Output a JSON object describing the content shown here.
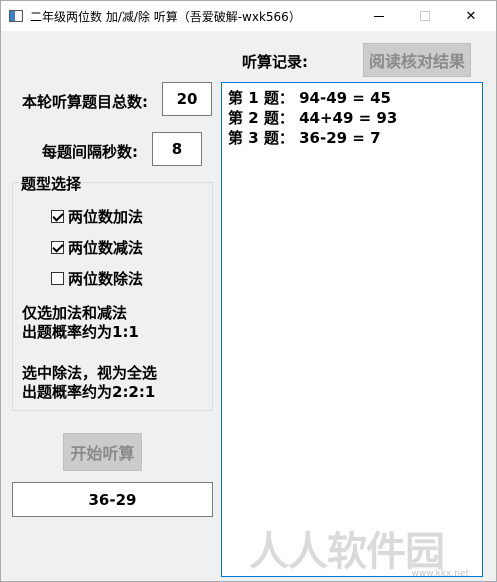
{
  "window": {
    "title": "二年级两位数 加/减/除 听算（吾爱破解-wxk566）",
    "minimize_icon": "minimize-icon",
    "maximize_icon": "maximize-icon",
    "close_glyph": "✕"
  },
  "settings": {
    "total_label": "本轮听算题目总数:",
    "total_value": "20",
    "interval_label": "每题间隔秒数:",
    "interval_value": "8"
  },
  "question_types": {
    "title": "题型选择",
    "options": [
      {
        "label": "两位数加法",
        "checked": true
      },
      {
        "label": "两位数减法",
        "checked": true
      },
      {
        "label": "两位数除法",
        "checked": false
      }
    ],
    "note1_line1": "仅选加法和减法",
    "note1_line2": "出题概率约为1:1",
    "note2_line1": "选中除法，视为全选",
    "note2_line2": "出题概率约为2:2:1"
  },
  "controls": {
    "start_label": "开始听算",
    "current_question": "36-29"
  },
  "records": {
    "title": "听算记录:",
    "check_button_label": "阅读核对结果",
    "lines": [
      "第 1 题：  94-49 = 45",
      "第 2 题：  44+49 = 93",
      "第 3 题：  36-29 = 7"
    ]
  },
  "watermark": {
    "text": "人人软件园",
    "url": "www.kkx.net"
  }
}
